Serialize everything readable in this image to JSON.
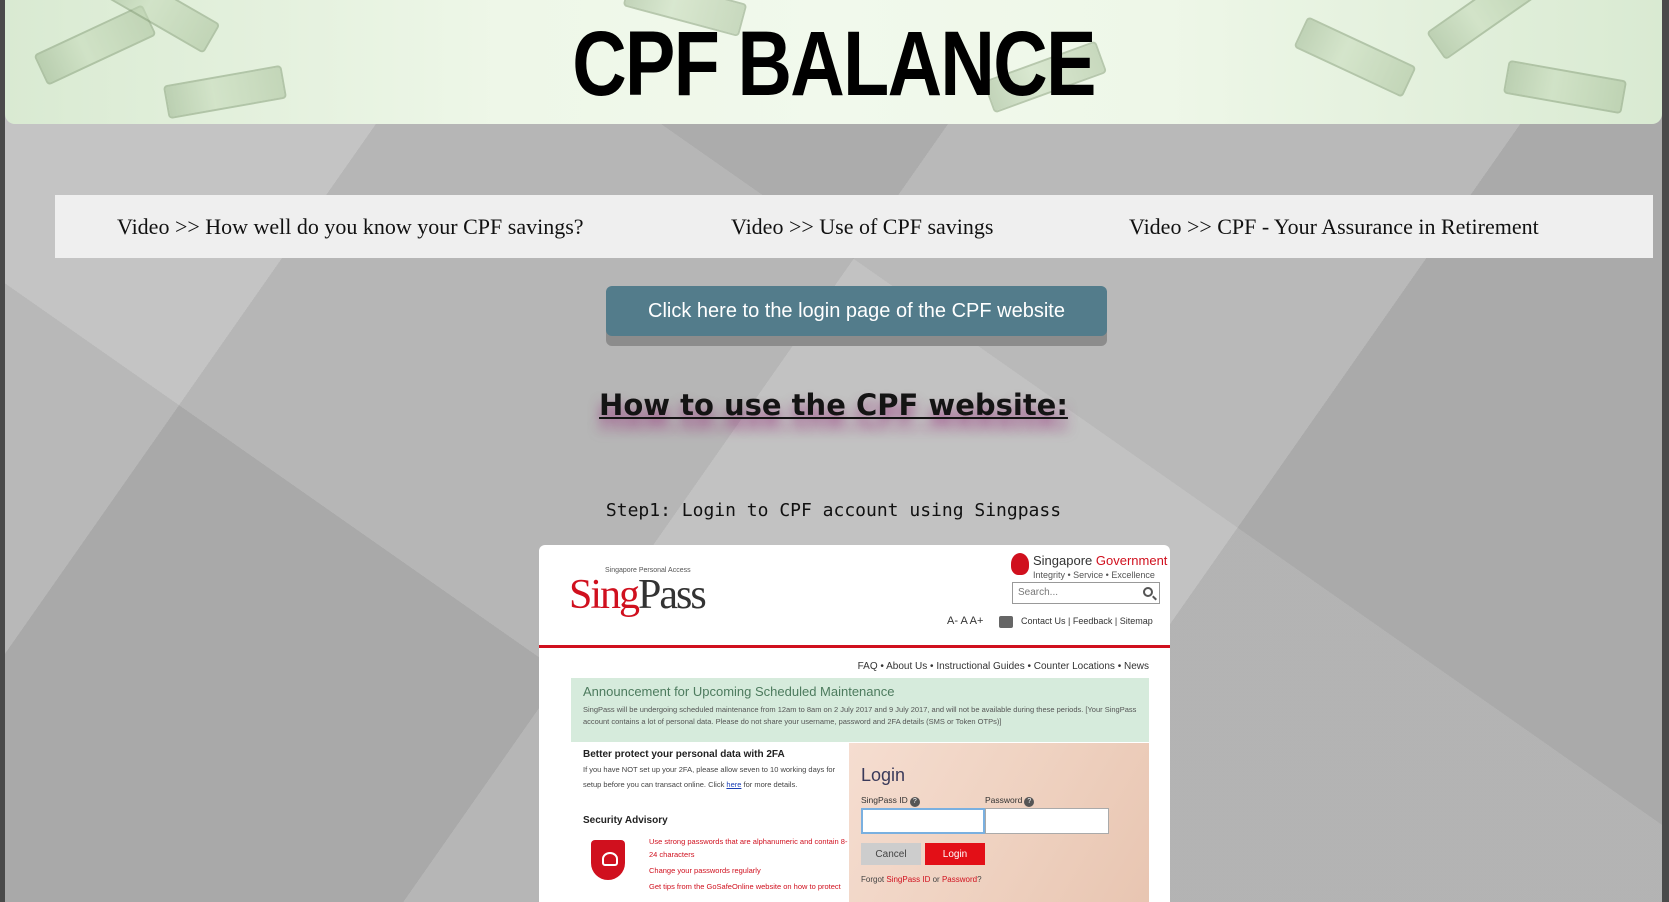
{
  "banner": {
    "title": "CPF BALANCE"
  },
  "nav": {
    "links": [
      "Video >> How well do you know your CPF savings?",
      "Video >> Use of CPF savings",
      "Video >> CPF - Your Assurance in Retirement"
    ]
  },
  "login_button": {
    "label": "Click here to the login page of the CPF website"
  },
  "how_to": {
    "title": "How to use the CPF website:",
    "step1": "Step1: Login to CPF account using Singpass"
  },
  "screenshot": {
    "logo_small": "Singapore Personal Access",
    "logo_sing": "Sing",
    "logo_pass": "Pass",
    "gov_name_a": "Singapore ",
    "gov_name_b": "Government",
    "gov_tagline": "Integrity • Service • Excellence",
    "search_placeholder": "Search...",
    "font_sizes": "A- A A+",
    "top_links": "Contact Us | Feedback | Sitemap",
    "menu": "FAQ • About Us • Instructional Guides • Counter Locations • News",
    "announcement_title": "Announcement for Upcoming Scheduled Maintenance",
    "announcement_body": "SingPass will be undergoing scheduled maintenance from 12am to 8am on 2 July 2017 and 9 July 2017, and will not be available during these periods. [Your SingPass account contains a lot of personal data. Please do not share your username, password and 2FA details (SMS or Token OTPs)]",
    "protect_title": "Better protect your personal data with 2FA",
    "protect_body_a": "If you have NOT set up your 2FA, please allow seven to 10 working days for setup before you can transact online. Click ",
    "protect_link": "here",
    "protect_body_b": " for more details.",
    "security_title": "Security Advisory",
    "tips": [
      "Use strong passwords that are alphanumeric and contain 8-24 characters",
      "Change your passwords regularly",
      "Get tips from the GoSafeOnline website on how to protect"
    ],
    "login_title": "Login",
    "singpass_id_label": "SingPass ID",
    "password_label": "Password",
    "cancel_label": "Cancel",
    "login_label": "Login",
    "forgot_a": "Forgot ",
    "forgot_b": "SingPass ID",
    "forgot_c": " or ",
    "forgot_d": "Password",
    "forgot_e": "?"
  }
}
